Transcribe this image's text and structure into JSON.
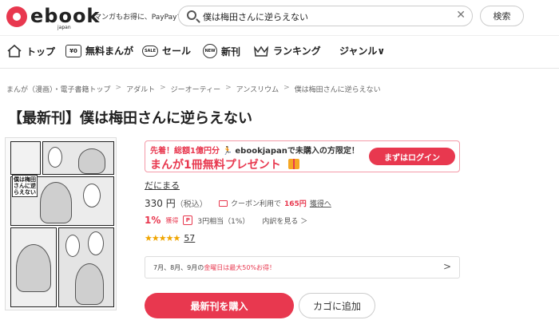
{
  "header": {
    "logo_text": "ebook",
    "logo_sub": "japan",
    "tagline": "マンガもお得に、PayPayで",
    "search": {
      "value": "僕は梅田さんに逆らえない",
      "icon": "search-icon",
      "clear_icon": "close-icon"
    },
    "search_button": "検索"
  },
  "nav": {
    "items": [
      {
        "label": "トップ",
        "icon": "home-icon"
      },
      {
        "label": "無料まんが",
        "icon": "free-icon",
        "icon_text": "¥0"
      },
      {
        "label": "セール",
        "icon": "sale-icon",
        "icon_text": "SALE"
      },
      {
        "label": "新刊",
        "icon": "new-icon",
        "icon_text": "NEW"
      },
      {
        "label": "ランキング",
        "icon": "crown-icon"
      },
      {
        "label": "ジャンル∨"
      }
    ]
  },
  "breadcrumb": [
    "まんが（漫画）・電子書籍トップ",
    "アダルト",
    "ジーオーティー",
    "アンスリウム",
    "僕は梅田さんに逆らえない"
  ],
  "breadcrumb_sep": ">",
  "title": "【最新刊】僕は梅田さんに逆らえない",
  "cover": {
    "title_text": "僕は梅田さんに逆らえない"
  },
  "promo": {
    "line1_prefix": "先着！総額1億円分",
    "line1_suffix": "ebookjapanで未購入の方限定！",
    "line2": "まんが1冊無料プレゼント",
    "login_button": "まずはログイン",
    "accent": "#e8384f"
  },
  "author": "だにまる",
  "price": {
    "amount": "330 円",
    "tax": "（税込）"
  },
  "coupon": {
    "text": "クーポン利用で",
    "amount": "165円",
    "link": "獲得へ"
  },
  "points": {
    "percent": "1%",
    "label": "獲得",
    "yen": "3円相当（1%）",
    "breakdown": "内訳を見る ＞"
  },
  "rating": {
    "stars": "★★★★★",
    "count": "57",
    "value": 4.5
  },
  "notice": {
    "prefix": "7月、8月、9月の",
    "highlight": "金曜日は最大50%お得！",
    "chevron": ">"
  },
  "buttons": {
    "buy": "最新刊を購入",
    "cart": "カゴに追加"
  }
}
